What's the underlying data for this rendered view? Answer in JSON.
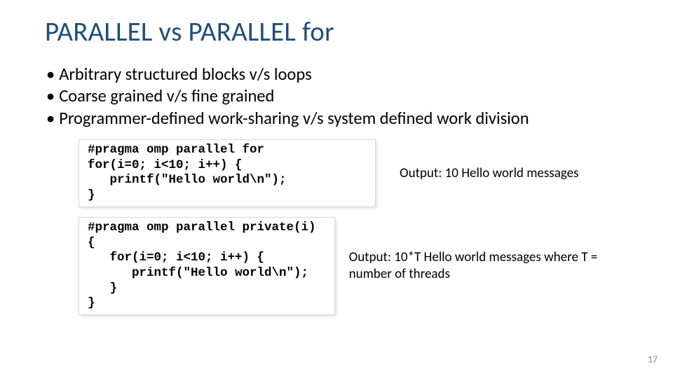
{
  "title": "PARALLEL vs PARALLEL for",
  "bullets": [
    "Arbitrary structured blocks v/s loops",
    "Coarse grained v/s fine grained",
    "Programmer-defined work-sharing v/s system defined work division"
  ],
  "code1": "#pragma omp parallel for\nfor(i=0; i<10; i++) {\n   printf(\"Hello world\\n\");\n}",
  "output1": "Output: 10 Hello world messages",
  "code2": "#pragma omp parallel private(i)\n{\n   for(i=0; i<10; i++) {\n      printf(\"Hello world\\n\");\n   }\n}",
  "output2": "Output: 10*T Hello world messages where T = number of threads",
  "page_number": "17"
}
